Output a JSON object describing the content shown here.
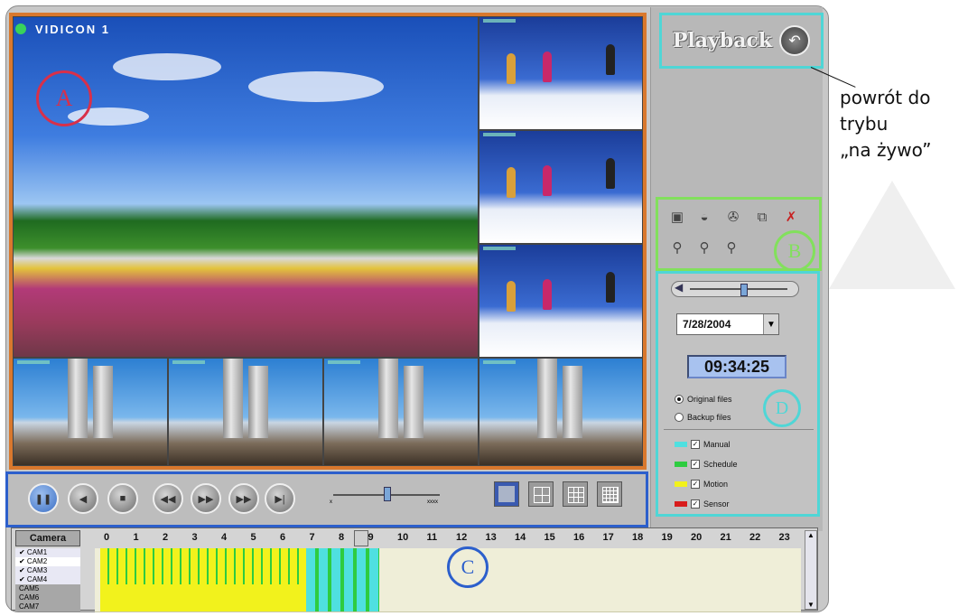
{
  "video": {
    "main_camera_label": "VIDICON 1"
  },
  "annotations": {
    "a": "A",
    "b": "B",
    "c": "C",
    "d": "D",
    "side_note_lines": [
      "powrót do",
      "trybu",
      "„na żywo”"
    ]
  },
  "playback": {
    "title": "Playback",
    "return_icon": "return-arrow-icon"
  },
  "tools": {
    "row1": [
      "camera-icon",
      "disk-icon",
      "film-reel-icon",
      "copy-icon",
      "delete-icon"
    ],
    "row2": [
      "zoom-icon",
      "zoom-in-icon",
      "zoom-out-icon"
    ]
  },
  "controls": {
    "volume_icon": "speaker-icon",
    "volume_level": 0.6,
    "date": "7/28/2004",
    "time": "09:34:25",
    "source_options": [
      {
        "label": "Original files",
        "selected": true
      },
      {
        "label": "Backup files",
        "selected": false
      }
    ],
    "legend": [
      {
        "label": "Manual",
        "color": "#4fe0e0",
        "checked": true
      },
      {
        "label": "Schedule",
        "color": "#2ecc40",
        "checked": true
      },
      {
        "label": "Motion",
        "color": "#f2f21c",
        "checked": true
      },
      {
        "label": "Sensor",
        "color": "#d81c1c",
        "checked": true
      }
    ]
  },
  "transport": {
    "buttons": [
      "pause-icon",
      "rewind-icon",
      "stop-icon",
      "prev-frame-icon",
      "next-frame-icon",
      "fast-forward-icon",
      "end-icon"
    ],
    "speed_min_label": "x",
    "speed_max_label": "xxxx",
    "speed_level": 0.5,
    "layouts": [
      "single-view-icon",
      "quad-view-icon",
      "nine-view-icon",
      "sixteen-view-icon"
    ]
  },
  "timeline": {
    "header": "Camera",
    "hours": [
      "0",
      "1",
      "2",
      "3",
      "4",
      "5",
      "6",
      "7",
      "8",
      "9",
      "10",
      "11",
      "12",
      "13",
      "14",
      "15",
      "16",
      "17",
      "18",
      "19",
      "20",
      "21",
      "22",
      "23"
    ],
    "cameras": [
      "CAM1",
      "CAM2",
      "CAM3",
      "CAM4",
      "CAM5",
      "CAM6",
      "CAM7"
    ],
    "checked": [
      true,
      true,
      true,
      true,
      false,
      false,
      false
    ],
    "current_hour": 9
  },
  "colors": {
    "annotation_a": "#d9782d",
    "annotation_b": "#82e05c",
    "annotation_cd": "#4fd6d6",
    "transport_border": "#2c5fcc"
  }
}
